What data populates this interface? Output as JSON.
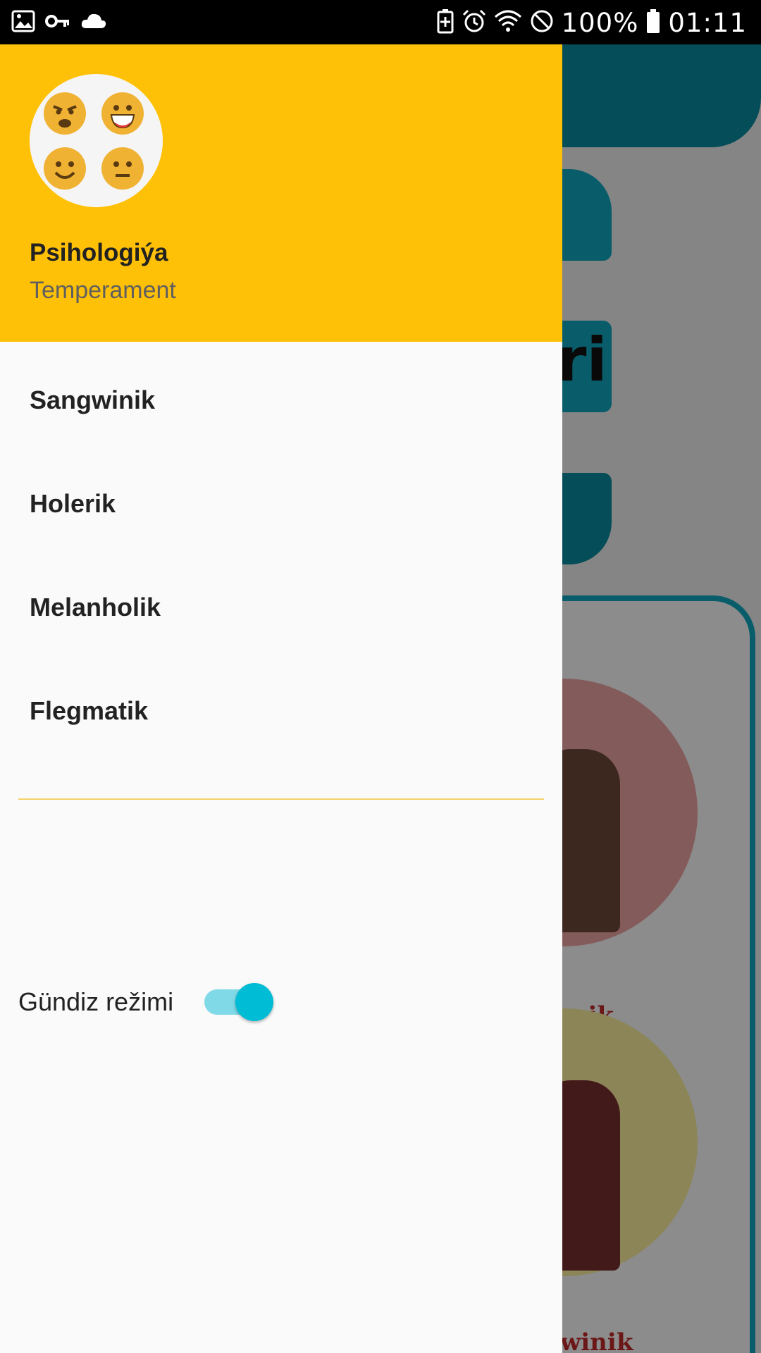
{
  "status_bar": {
    "left_icons": [
      "image-icon",
      "key-icon",
      "cloud-icon"
    ],
    "right_icons": [
      "battery-saver-icon",
      "alarm-icon",
      "wifi-icon",
      "do-not-disturb-icon",
      "battery-icon"
    ],
    "battery": "100%",
    "time": "01:11"
  },
  "drawer": {
    "header": {
      "title": "Psihologiýa",
      "subtitle": "Temperament",
      "background_color": "#ffc107"
    },
    "menu_items": [
      {
        "label": "Sangwinik"
      },
      {
        "label": "Holerik"
      },
      {
        "label": "Melanholik"
      },
      {
        "label": "Flegmatik"
      }
    ],
    "mode_toggle": {
      "label": "Gündiz režimi",
      "checked": true,
      "color": "#00bcd4"
    }
  },
  "background": {
    "button_partial_text": "ri",
    "card_labels": [
      "erik",
      "winik"
    ],
    "accent_color": "#12aac2"
  }
}
